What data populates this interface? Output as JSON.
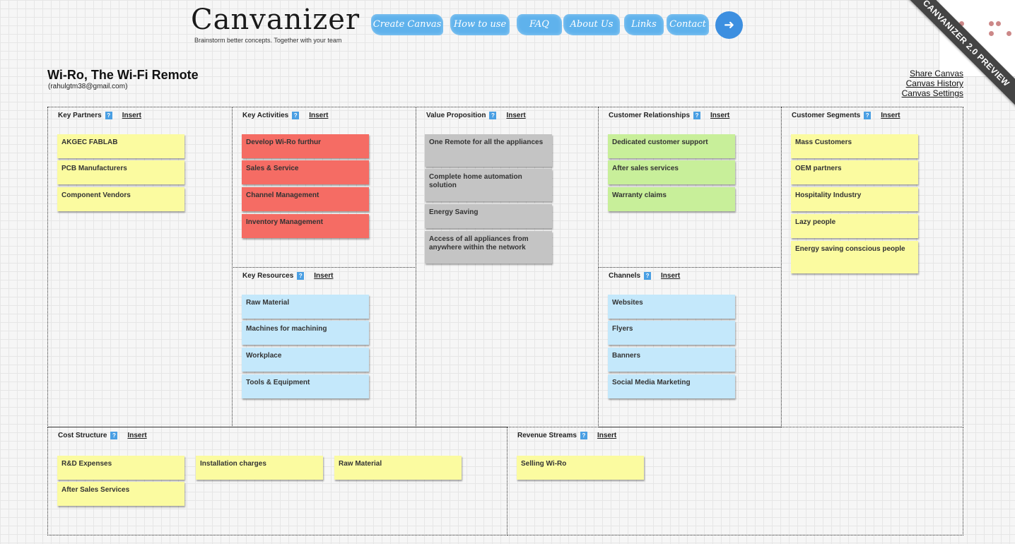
{
  "app": {
    "logo": "Canvanizer",
    "tagline": "Brainstorm better concepts. Together with your team",
    "ribbon": "CANVANIZER 2.0 PREVIEW"
  },
  "nav": [
    {
      "label": "Create Canvas"
    },
    {
      "label": "How to use"
    },
    {
      "label": "FAQ"
    },
    {
      "label": "About Us"
    },
    {
      "label": "Links"
    },
    {
      "label": "Contact"
    }
  ],
  "login_icon": "sign-in-icon",
  "canvas": {
    "title": "Wi-Ro, The Wi-Fi Remote",
    "email": "(rahulgtm38@gmail.com)"
  },
  "links": {
    "share": "Share Canvas",
    "history": "Canvas History",
    "settings": "Canvas Settings"
  },
  "insert_label": "Insert",
  "help_glyph": "?",
  "colors": {
    "yellow": "#fbfba0",
    "red": "#f56c64",
    "grey": "#c4c4c4",
    "green": "#c8ef9a",
    "blue": "#c4e8fb",
    "nav": "#5fb2ec",
    "login": "#3d8fe0"
  },
  "sections": {
    "key_partners": {
      "title": "Key Partners",
      "notes": [
        "AKGEC FABLAB",
        "PCB Manufacturers",
        "Component Vendors"
      ]
    },
    "key_activities": {
      "title": "Key Activities",
      "notes": [
        "Develop Wi-Ro furthur",
        "Sales & Service",
        "Channel Management",
        "Inventory Management"
      ]
    },
    "key_resources": {
      "title": "Key Resources",
      "notes": [
        "Raw Material",
        "Machines for machining",
        "Workplace",
        "Tools & Equipment"
      ]
    },
    "value_proposition": {
      "title": "Value Proposition",
      "notes": [
        "One Remote for all the appliances",
        "Complete home automation solution",
        "Energy Saving",
        "Access of all appliances from anywhere within the network"
      ]
    },
    "customer_relationships": {
      "title": "Customer Relationships",
      "notes": [
        "Dedicated customer support",
        "After sales services",
        "Warranty claims"
      ]
    },
    "channels": {
      "title": "Channels",
      "notes": [
        "Websites",
        "Flyers",
        "Banners",
        "Social Media Marketing"
      ]
    },
    "customer_segments": {
      "title": "Customer Segments",
      "notes": [
        "Mass Customers",
        "OEM partners",
        "Hospitality Industry",
        "Lazy people",
        "Energy saving conscious people"
      ]
    },
    "cost_structure": {
      "title": "Cost Structure",
      "notes": [
        "R&D Expenses",
        "Installation charges",
        "Raw Material",
        "After Sales Services"
      ]
    },
    "revenue_streams": {
      "title": "Revenue Streams",
      "notes": [
        "Selling Wi-Ro"
      ]
    }
  }
}
